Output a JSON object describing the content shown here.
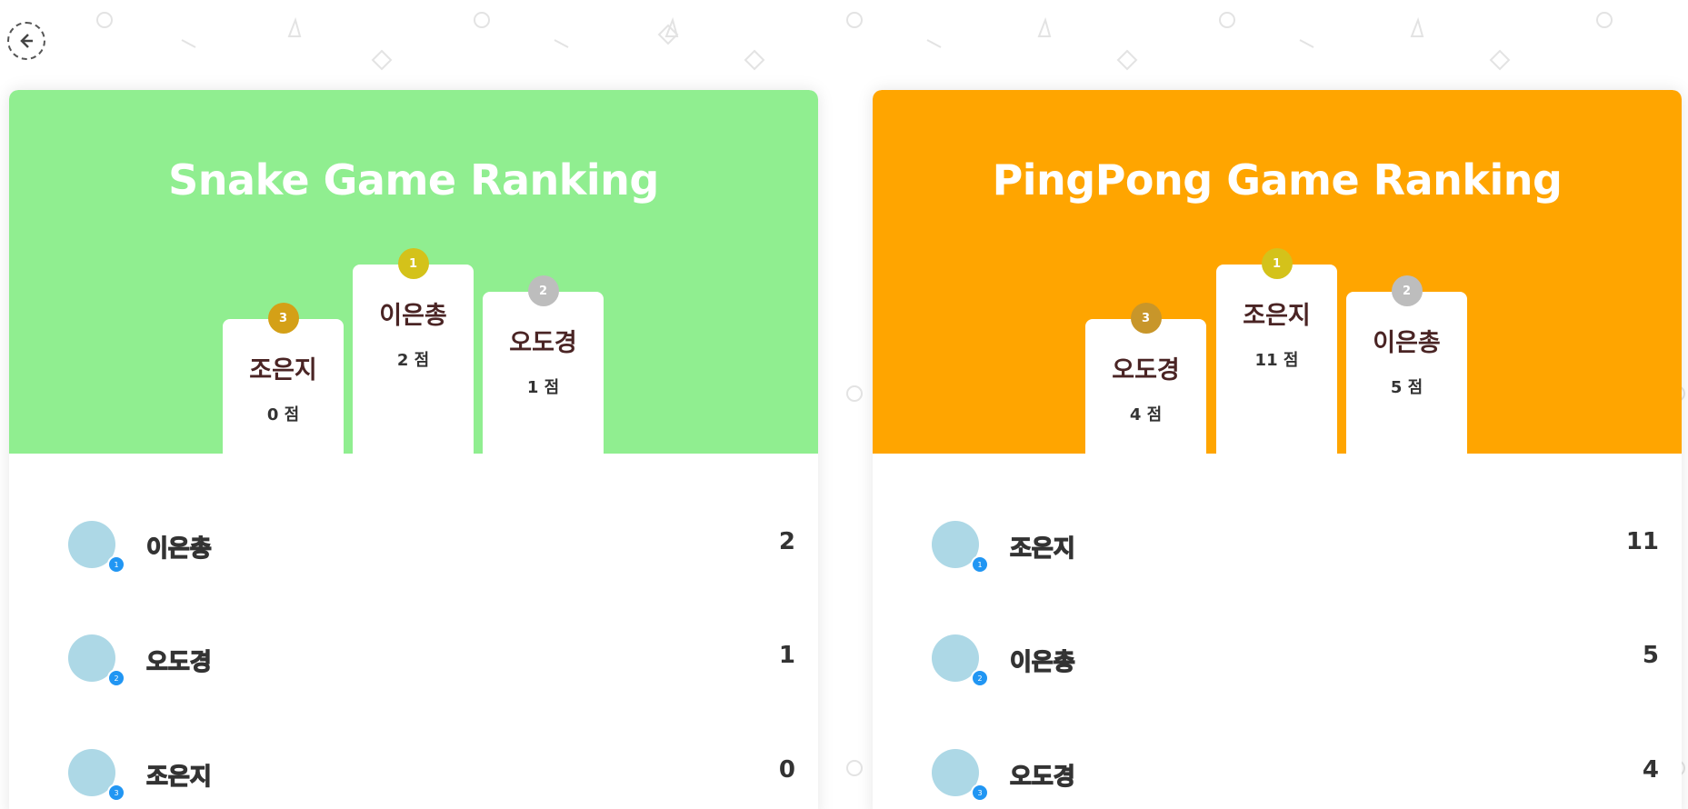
{
  "back_icon": "arrow-left-circle-icon",
  "panels": [
    {
      "title": "Snake Game Ranking",
      "header_color": "#90ee90",
      "podium": [
        {
          "place": "3",
          "name": "조은지",
          "score": "0 점",
          "badge_color": "#d4a017"
        },
        {
          "place": "1",
          "name": "이은총",
          "score": "2 점",
          "badge_color": "#d4c21a"
        },
        {
          "place": "2",
          "name": "오도경",
          "score": "1 점",
          "badge_color": "#bdbdbd"
        }
      ],
      "list": [
        {
          "rank": "1",
          "name": "이은총",
          "score": "2"
        },
        {
          "rank": "2",
          "name": "오도경",
          "score": "1"
        },
        {
          "rank": "3",
          "name": "조은지",
          "score": "0"
        }
      ]
    },
    {
      "title": "PingPong Game Ranking",
      "header_color": "#ffa500",
      "podium": [
        {
          "place": "3",
          "name": "오도경",
          "score": "4 점",
          "badge_color": "#c8962a"
        },
        {
          "place": "1",
          "name": "조은지",
          "score": "11 점",
          "badge_color": "#d4c21a"
        },
        {
          "place": "2",
          "name": "이은총",
          "score": "5 점",
          "badge_color": "#bdbdbd"
        }
      ],
      "list": [
        {
          "rank": "1",
          "name": "조은지",
          "score": "11"
        },
        {
          "rank": "2",
          "name": "이은총",
          "score": "5"
        },
        {
          "rank": "3",
          "name": "오도경",
          "score": "4"
        }
      ]
    }
  ]
}
